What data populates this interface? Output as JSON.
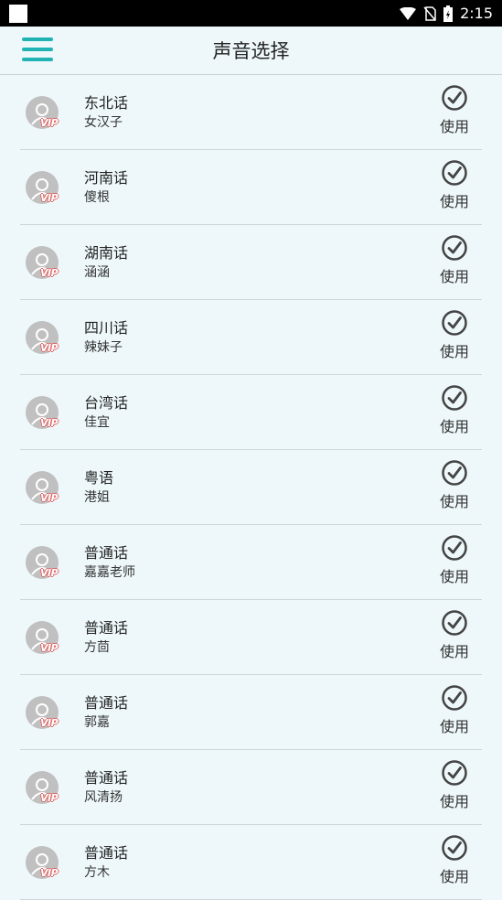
{
  "status_bar": {
    "time": "2:15"
  },
  "header": {
    "title": "声音选择"
  },
  "colors": {
    "accent": "#21b3b3",
    "vip": "#e06666",
    "background": "#eef8fb"
  },
  "voices": [
    {
      "dialect": "东北话",
      "name": "女汉子",
      "badge": "VIP",
      "action": "使用"
    },
    {
      "dialect": "河南话",
      "name": "傻根",
      "badge": "VIP",
      "action": "使用"
    },
    {
      "dialect": "湖南话",
      "name": "涵涵",
      "badge": "VIP",
      "action": "使用"
    },
    {
      "dialect": "四川话",
      "name": "辣妹子",
      "badge": "VIP",
      "action": "使用"
    },
    {
      "dialect": "台湾话",
      "name": "佳宜",
      "badge": "VIP",
      "action": "使用"
    },
    {
      "dialect": "粤语",
      "name": "港姐",
      "badge": "VIP",
      "action": "使用"
    },
    {
      "dialect": "普通话",
      "name": "嘉嘉老师",
      "badge": "VIP",
      "action": "使用"
    },
    {
      "dialect": "普通话",
      "name": "方茴",
      "badge": "VIP",
      "action": "使用"
    },
    {
      "dialect": "普通话",
      "name": "郭嘉",
      "badge": "VIP",
      "action": "使用"
    },
    {
      "dialect": "普通话",
      "name": "风清扬",
      "badge": "VIP",
      "action": "使用"
    },
    {
      "dialect": "普通话",
      "name": "方木",
      "badge": "VIP",
      "action": "使用"
    }
  ]
}
